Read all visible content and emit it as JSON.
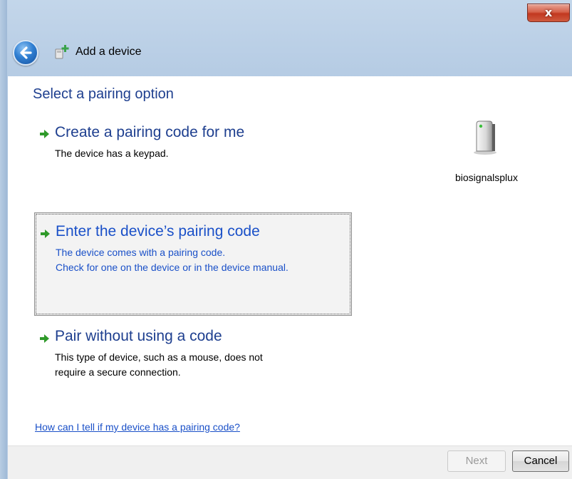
{
  "window": {
    "title": "Add a device",
    "close_glyph": "x",
    "back_icon": "back-arrow-icon",
    "title_icon": "add-device-icon"
  },
  "main": {
    "heading": "Select a pairing option",
    "options": [
      {
        "title": "Create a pairing code for me",
        "description_lines": [
          "The device has a keypad."
        ],
        "selected": false
      },
      {
        "title": "Enter the device’s pairing code",
        "description_lines": [
          "The device comes with a pairing code.",
          "Check for one on the device or in the device manual."
        ],
        "selected": true
      },
      {
        "title": "Pair without using a code",
        "description_lines": [
          "This type of device, such as a mouse, does not",
          "require a secure connection."
        ],
        "selected": false
      }
    ],
    "device": {
      "label": "biosignalsplux",
      "icon": "device-tower-icon"
    },
    "help_link": "How can I tell if my device has a pairing code?"
  },
  "footer": {
    "next_label": "Next",
    "next_enabled": false,
    "cancel_label": "Cancel"
  },
  "colors": {
    "heading": "#1e3f8f",
    "link": "#1a50c8",
    "arrow_green": "#2f9a2a",
    "selected_bg": "#f3f3f3"
  }
}
